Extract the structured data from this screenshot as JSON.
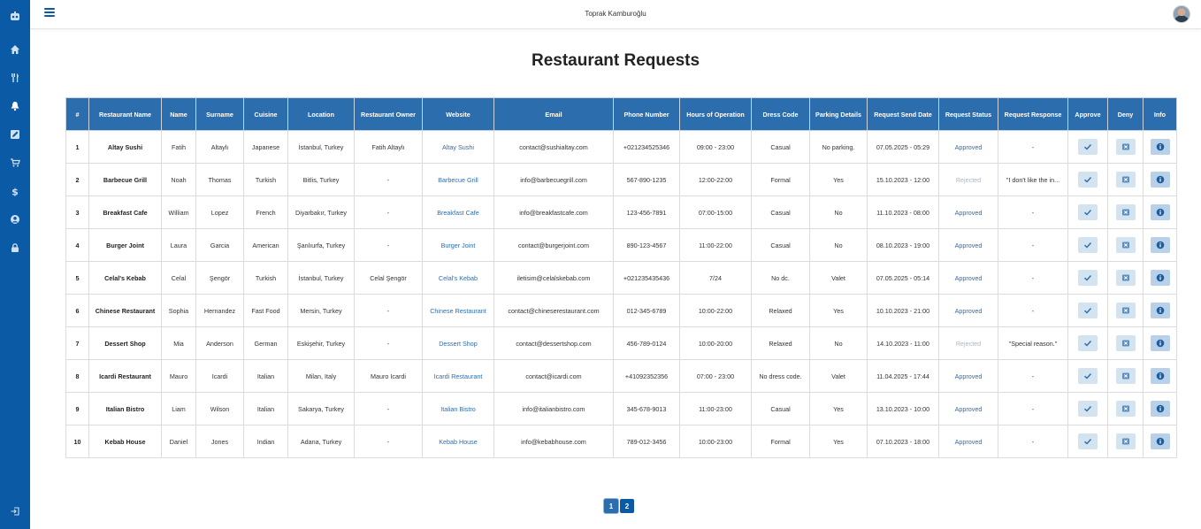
{
  "header": {
    "username": "Toprak Kamburoğlu"
  },
  "page": {
    "title": "Restaurant Requests"
  },
  "sidebar": {
    "items": [
      {
        "name": "home-icon"
      },
      {
        "name": "restaurant-icon"
      },
      {
        "name": "bell-icon"
      },
      {
        "name": "edit-icon"
      },
      {
        "name": "cart-icon"
      },
      {
        "name": "dollar-icon"
      },
      {
        "name": "user-icon"
      },
      {
        "name": "lock-icon"
      }
    ]
  },
  "table": {
    "columns": [
      "#",
      "Restaurant Name",
      "Name",
      "Surname",
      "Cuisine",
      "Location",
      "Restaurant Owner",
      "Website",
      "Email",
      "Phone Number",
      "Hours of Operation",
      "Dress Code",
      "Parking Details",
      "Request Send Date",
      "Request Status",
      "Request Response",
      "Approve",
      "Deny",
      "Info"
    ],
    "rows": [
      {
        "num": "1",
        "restaurant": "Altay Sushi",
        "name": "Fatih",
        "surname": "Altaylı",
        "cuisine": "Japanese",
        "location": "İstanbul, Turkey",
        "owner": "Fatih Altaylı",
        "website": "Altay Sushi",
        "email": "contact@sushialtay.com",
        "phone": "+021234525346",
        "hours": "09:00 - 23:00",
        "dress": "Casual",
        "parking": "No parking.",
        "date": "07.05.2025 - 05:29",
        "status": "Approved",
        "response": "-"
      },
      {
        "num": "2",
        "restaurant": "Barbecue Grill",
        "name": "Noah",
        "surname": "Thomas",
        "cuisine": "Turkish",
        "location": "Bitlis, Turkey",
        "owner": "-",
        "website": "Barbecue Grill",
        "email": "info@barbecuegrill.com",
        "phone": "567-890-1235",
        "hours": "12:00-22:00",
        "dress": "Formal",
        "parking": "Yes",
        "date": "15.10.2023 - 12:00",
        "status": "Rejected",
        "response": "\"I don't like the in..."
      },
      {
        "num": "3",
        "restaurant": "Breakfast Cafe",
        "name": "William",
        "surname": "Lopez",
        "cuisine": "French",
        "location": "Diyarbakır, Turkey",
        "owner": "-",
        "website": "Breakfast Cafe",
        "email": "info@breakfastcafe.com",
        "phone": "123-456-7891",
        "hours": "07:00-15:00",
        "dress": "Casual",
        "parking": "No",
        "date": "11.10.2023 - 08:00",
        "status": "Approved",
        "response": "-"
      },
      {
        "num": "4",
        "restaurant": "Burger Joint",
        "name": "Laura",
        "surname": "Garcia",
        "cuisine": "American",
        "location": "Şanlıurfa, Turkey",
        "owner": "-",
        "website": "Burger Joint",
        "email": "contact@burgerjoint.com",
        "phone": "890-123-4567",
        "hours": "11:00-22:00",
        "dress": "Casual",
        "parking": "No",
        "date": "08.10.2023 - 19:00",
        "status": "Approved",
        "response": "-"
      },
      {
        "num": "5",
        "restaurant": "Celal's Kebab",
        "name": "Celal",
        "surname": "Şengör",
        "cuisine": "Turkish",
        "location": "İstanbul, Turkey",
        "owner": "Celal Şengör",
        "website": "Celal's Kebab",
        "email": "iletisim@celalskebab.com",
        "phone": "+021235435436",
        "hours": "7/24",
        "dress": "No dc.",
        "parking": "Valet",
        "date": "07.05.2025 - 05:14",
        "status": "Approved",
        "response": "-"
      },
      {
        "num": "6",
        "restaurant": "Chinese Restaurant",
        "name": "Sophia",
        "surname": "Hernandez",
        "cuisine": "Fast Food",
        "location": "Mersin, Turkey",
        "owner": "-",
        "website": "Chinese Restaurant",
        "email": "contact@chineserestaurant.com",
        "phone": "012-345-6789",
        "hours": "10:00-22:00",
        "dress": "Relaxed",
        "parking": "Yes",
        "date": "10.10.2023 - 21:00",
        "status": "Approved",
        "response": "-"
      },
      {
        "num": "7",
        "restaurant": "Dessert Shop",
        "name": "Mia",
        "surname": "Anderson",
        "cuisine": "German",
        "location": "Eskişehir, Turkey",
        "owner": "-",
        "website": "Dessert Shop",
        "email": "contact@dessertshop.com",
        "phone": "456-789-0124",
        "hours": "10:00-20:00",
        "dress": "Relaxed",
        "parking": "No",
        "date": "14.10.2023 - 11:00",
        "status": "Rejected",
        "response": "\"Special reason.\""
      },
      {
        "num": "8",
        "restaurant": "Icardi Restaurant",
        "name": "Mauro",
        "surname": "Icardi",
        "cuisine": "Italian",
        "location": "Milan, Italy",
        "owner": "Mauro Icardi",
        "website": "Icardi Restaurant",
        "email": "contact@icardi.com",
        "phone": "+41092352356",
        "hours": "07:00 - 23:00",
        "dress": "No dress code.",
        "parking": "Valet",
        "date": "11.04.2025 - 17:44",
        "status": "Approved",
        "response": "-"
      },
      {
        "num": "9",
        "restaurant": "Italian Bistro",
        "name": "Liam",
        "surname": "Wilson",
        "cuisine": "Italian",
        "location": "Sakarya, Turkey",
        "owner": "-",
        "website": "Italian Bistro",
        "email": "info@italianbistro.com",
        "phone": "345-678-9013",
        "hours": "11:00-23:00",
        "dress": "Casual",
        "parking": "Yes",
        "date": "13.10.2023 - 10:00",
        "status": "Approved",
        "response": "-"
      },
      {
        "num": "10",
        "restaurant": "Kebab House",
        "name": "Daniel",
        "surname": "Jones",
        "cuisine": "Indian",
        "location": "Adana, Turkey",
        "owner": "-",
        "website": "Kebab House",
        "email": "info@kebabhouse.com",
        "phone": "789-012-3456",
        "hours": "10:00-23:00",
        "dress": "Formal",
        "parking": "Yes",
        "date": "07.10.2023 - 18:00",
        "status": "Approved",
        "response": "-"
      }
    ]
  },
  "pagination": {
    "pages": [
      "1",
      "2"
    ],
    "current": "1"
  },
  "colors": {
    "sidebar": "#0b5aa5",
    "header": "#2c6dad",
    "approved": "#2c6dad",
    "rejected": "#aab6c3"
  }
}
